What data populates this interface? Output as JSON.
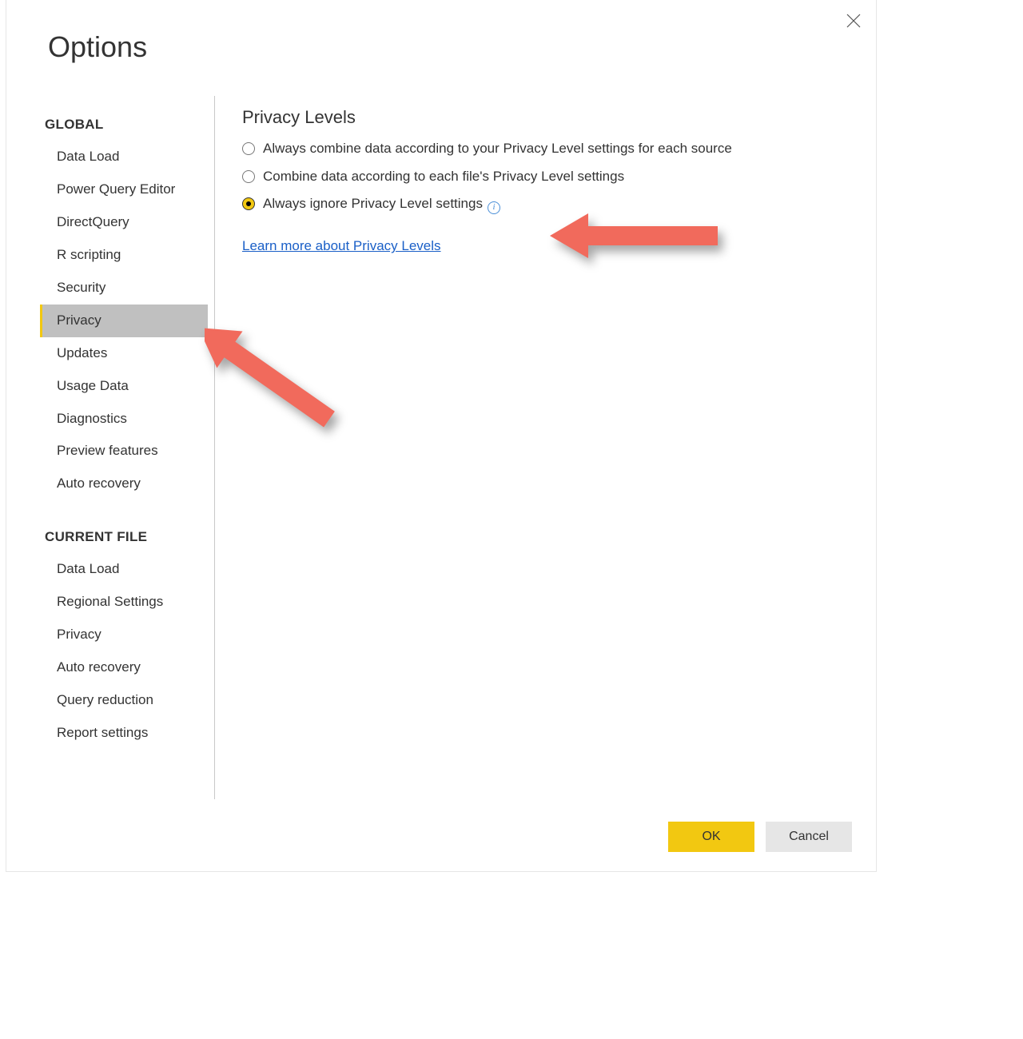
{
  "dialog": {
    "title": "Options"
  },
  "sidebar": {
    "sections": [
      {
        "header": "GLOBAL",
        "items": [
          {
            "label": "Data Load",
            "selected": false
          },
          {
            "label": "Power Query Editor",
            "selected": false
          },
          {
            "label": "DirectQuery",
            "selected": false
          },
          {
            "label": "R scripting",
            "selected": false
          },
          {
            "label": "Security",
            "selected": false
          },
          {
            "label": "Privacy",
            "selected": true
          },
          {
            "label": "Updates",
            "selected": false
          },
          {
            "label": "Usage Data",
            "selected": false
          },
          {
            "label": "Diagnostics",
            "selected": false
          },
          {
            "label": "Preview features",
            "selected": false
          },
          {
            "label": "Auto recovery",
            "selected": false
          }
        ]
      },
      {
        "header": "CURRENT FILE",
        "items": [
          {
            "label": "Data Load",
            "selected": false
          },
          {
            "label": "Regional Settings",
            "selected": false
          },
          {
            "label": "Privacy",
            "selected": false
          },
          {
            "label": "Auto recovery",
            "selected": false
          },
          {
            "label": "Query reduction",
            "selected": false
          },
          {
            "label": "Report settings",
            "selected": false
          }
        ]
      }
    ]
  },
  "content": {
    "heading": "Privacy Levels",
    "options": [
      {
        "label": "Always combine data according to your Privacy Level settings for each source",
        "selected": false,
        "info": false
      },
      {
        "label": "Combine data according to each file's Privacy Level settings",
        "selected": false,
        "info": false
      },
      {
        "label": "Always ignore Privacy Level settings",
        "selected": true,
        "info": true
      }
    ],
    "learn_link": "Learn more about Privacy Levels"
  },
  "footer": {
    "ok": "OK",
    "cancel": "Cancel"
  },
  "colors": {
    "accent": "#f2c811",
    "link": "#1a5fc7",
    "annotation": "#f16a5c"
  }
}
